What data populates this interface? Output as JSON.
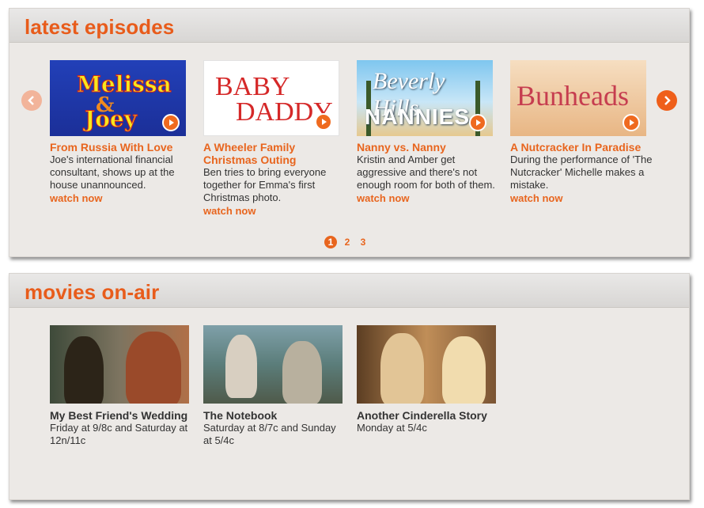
{
  "colors": {
    "accent": "#e8651e",
    "title": "#e85c1b",
    "panel_bg": "#ece9e6"
  },
  "episodes": {
    "title": "latest episodes",
    "prev_icon": "chevron-left-icon",
    "next_icon": "chevron-right-icon",
    "items": [
      {
        "logo": [
          "Melissa",
          "&",
          "Joey"
        ],
        "title": "From Russia With Love",
        "description": "Joe's international financial consultant, shows up at the house unannounced.",
        "watch": "watch now"
      },
      {
        "logo": [
          "BABY",
          "DADDY"
        ],
        "title": "A Wheeler Family Christmas Outing",
        "description": "Ben tries to bring everyone together for Emma's first Christmas photo.",
        "watch": "watch now"
      },
      {
        "logo": [
          "Beverly Hills",
          "NANNIES"
        ],
        "title": "Nanny vs. Nanny",
        "description": "Kristin and Amber get aggressive and there's not enough room for both of them.",
        "watch": "watch now"
      },
      {
        "logo": [
          "Bunheads"
        ],
        "title": "A Nutcracker In Paradise",
        "description": "During the performance of 'The Nutcracker' Michelle makes a mistake.",
        "watch": "watch now"
      }
    ],
    "pages": [
      "1",
      "2",
      "3"
    ],
    "current_page": "1"
  },
  "movies": {
    "title": "movies on-air",
    "items": [
      {
        "title": "My Best Friend's Wedding",
        "schedule": "Friday at 9/8c and Saturday at 12n/11c"
      },
      {
        "title": "The Notebook",
        "schedule": "Saturday at 8/7c and Sunday at 5/4c"
      },
      {
        "title": "Another Cinderella Story",
        "schedule": "Monday at 5/4c"
      }
    ]
  }
}
